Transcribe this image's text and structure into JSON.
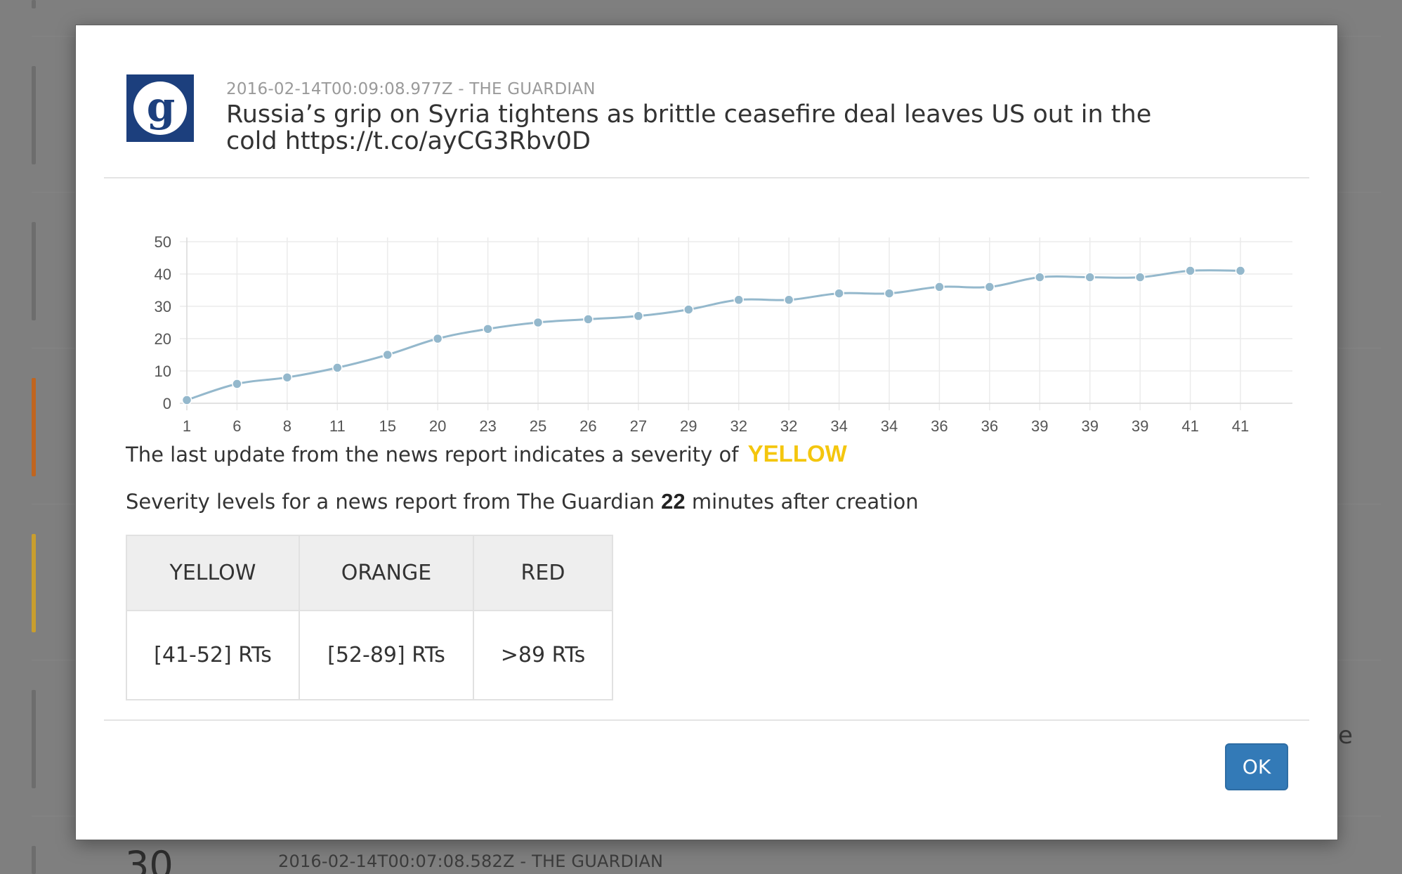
{
  "background": {
    "item_date_source": "2016-02-14T00:07:08.582Z - THE GUARDIAN",
    "item_count": "30",
    "right_fragment": "e"
  },
  "modal": {
    "source_logo_letter": "g",
    "meta": "2016-02-14T00:09:08.977Z - THE GUARDIAN",
    "headline": "Russia’s grip on Syria tightens as brittle ceasefire deal leaves US out in the cold https://t.co/ayCG3Rbv0D",
    "severity_text": "The last update from the news report indicates a severity of",
    "severity_value": "YELLOW",
    "levels_prefix": "Severity levels for a news report from The Guardian",
    "levels_minutes": "22",
    "levels_suffix": "minutes after creation",
    "table": {
      "headers": [
        "YELLOW",
        "ORANGE",
        "RED"
      ],
      "values": [
        "[41-52] RTs",
        "[52-89] RTs",
        ">89 RTs"
      ]
    },
    "ok_label": "OK"
  },
  "colors": {
    "severity_yellow": "#f4c60e",
    "line": "#94b8cc",
    "button": "#337ab7",
    "bar_orange": "#c0651f",
    "bar_yellow": "#c99e2e"
  },
  "chart_data": {
    "type": "line",
    "categories": [
      "1",
      "6",
      "8",
      "11",
      "15",
      "20",
      "23",
      "25",
      "26",
      "27",
      "29",
      "32",
      "32",
      "34",
      "34",
      "36",
      "36",
      "39",
      "39",
      "39",
      "41",
      "41"
    ],
    "values": [
      1,
      6,
      8,
      11,
      15,
      20,
      23,
      25,
      26,
      27,
      29,
      32,
      32,
      34,
      34,
      36,
      36,
      39,
      39,
      39,
      41,
      41
    ],
    "yticks": [
      0,
      10,
      20,
      30,
      40,
      50
    ],
    "ylim": [
      0,
      50
    ],
    "grid": true,
    "legend": "none"
  }
}
